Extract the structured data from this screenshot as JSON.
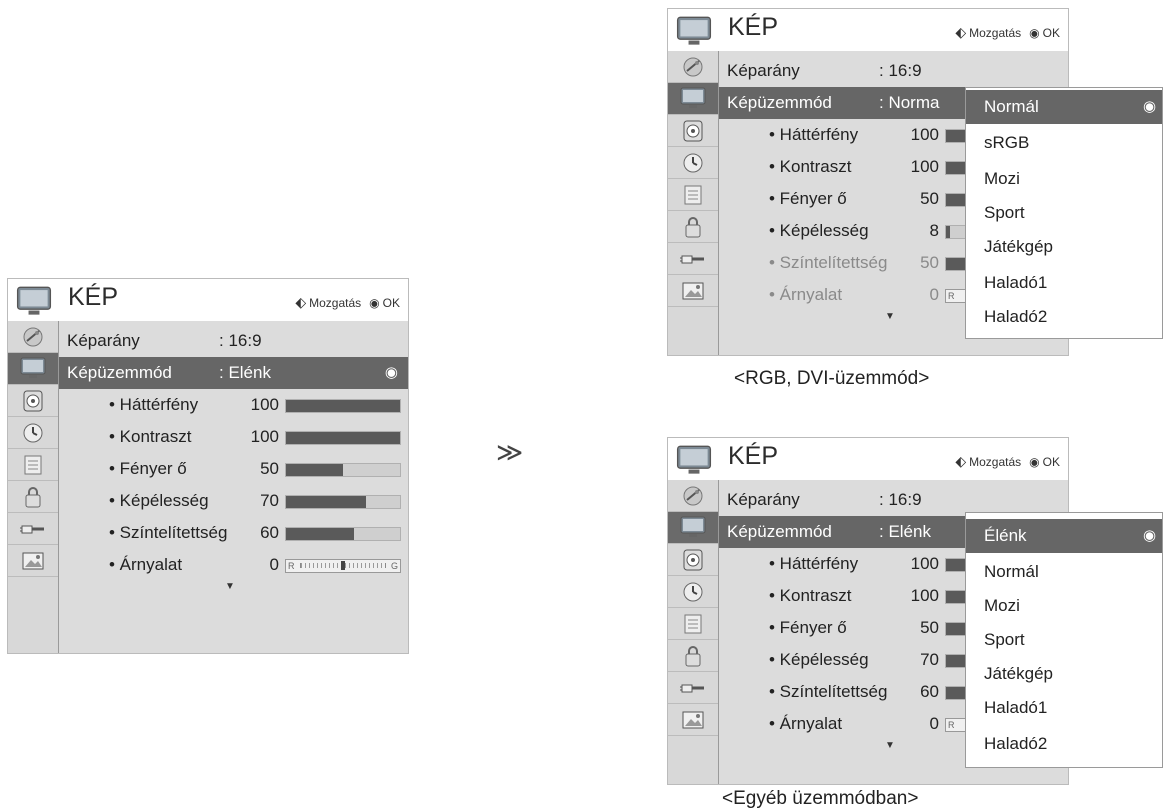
{
  "chevron": "≫",
  "icons": [
    "picture-source-icon",
    "picture-icon",
    "audio-icon",
    "time-icon",
    "option-icon",
    "lock-icon",
    "input-icon",
    "usb-photo-icon"
  ],
  "left_menu": {
    "title": "KÉP",
    "hint_move": "Mozgatás",
    "hint_ok": "OK",
    "aspect_label": "Képarány",
    "aspect_value": ": 16:9",
    "mode_label": "Képüzemmód",
    "mode_value": ": Elénk",
    "items": [
      {
        "label": "• Háttérfény",
        "value": "100",
        "level": 1.0
      },
      {
        "label": "• Kontraszt",
        "value": "100",
        "level": 1.0
      },
      {
        "label": "• Fényer ő",
        "value": "50",
        "level": 0.5
      },
      {
        "label": "• Képélesség",
        "value": "70",
        "level": 0.7
      },
      {
        "label": "• Színtelítettség",
        "value": "60",
        "level": 0.6
      },
      {
        "label": "• Árnyalat",
        "value": "0",
        "scale_left": "R",
        "scale_right": "G"
      }
    ]
  },
  "rgb_menu": {
    "title": "KÉP",
    "hint_move": "Mozgatás",
    "hint_ok": "OK",
    "aspect_label": "Képarány",
    "aspect_value": ": 16:9",
    "mode_label": "Képüzemmód",
    "mode_value": ": Norma",
    "items": [
      {
        "label": "• Háttérfény",
        "value": "100"
      },
      {
        "label": "• Kontraszt",
        "value": "100"
      },
      {
        "label": "• Fényer ő",
        "value": "50"
      },
      {
        "label": "• Képélesség",
        "value": "8"
      },
      {
        "label": "• Színtelítettség",
        "value": "50"
      },
      {
        "label": "• Árnyalat",
        "value": "0",
        "scale_left": "R"
      }
    ],
    "dropdown": [
      "Normál",
      "sRGB",
      "Mozi",
      "Sport",
      "Játékgép",
      "Haladó1",
      "Haladó2"
    ],
    "caption": "<RGB, DVI-üzemmód>"
  },
  "other_menu": {
    "title": "KÉP",
    "hint_move": "Mozgatás",
    "hint_ok": "OK",
    "aspect_label": "Képarány",
    "aspect_value": ": 16:9",
    "mode_label": "Képüzemmód",
    "mode_value": ": Elénk",
    "items": [
      {
        "label": "• Háttérfény",
        "value": "100"
      },
      {
        "label": "• Kontraszt",
        "value": "100"
      },
      {
        "label": "• Fényer ő",
        "value": "50"
      },
      {
        "label": "• Képélesség",
        "value": "70"
      },
      {
        "label": "• Színtelítettség",
        "value": "60"
      },
      {
        "label": "• Árnyalat",
        "value": "0",
        "scale_left": "R"
      }
    ],
    "dropdown": [
      "Élénk",
      "Normál",
      "Mozi",
      "Sport",
      "Játékgép",
      "Haladó1",
      "Haladó2"
    ],
    "caption": "<Egyéb üzemmódban>"
  }
}
